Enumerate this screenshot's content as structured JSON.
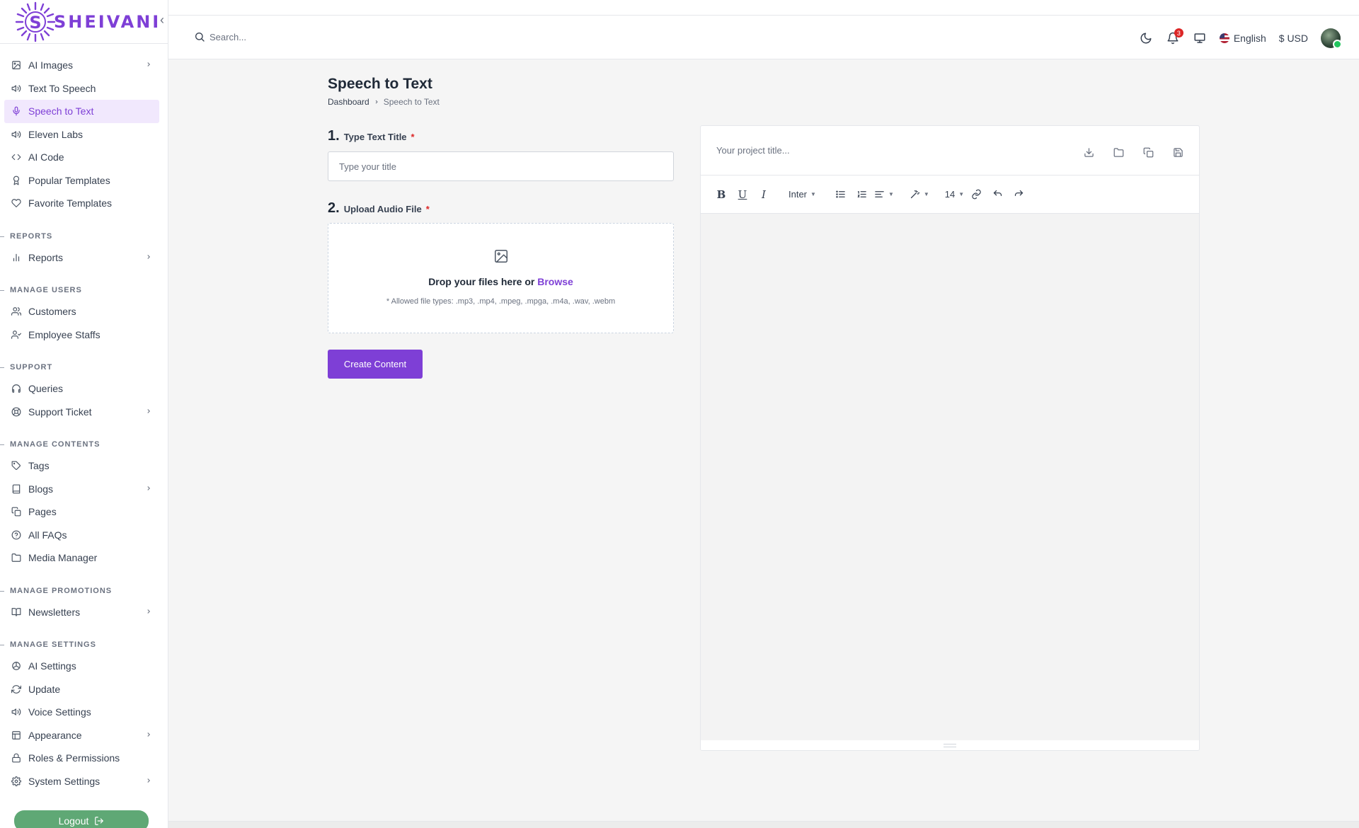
{
  "brand": {
    "name": "SHEIVANI"
  },
  "sidebar": {
    "items_main": [
      {
        "label": "AI Images",
        "icon": "image-icon",
        "chevron": true
      },
      {
        "label": "Text To Speech",
        "icon": "speaker-icon",
        "chevron": false
      },
      {
        "label": "Speech to Text",
        "icon": "microphone-icon",
        "chevron": false,
        "active": true
      },
      {
        "label": "Eleven Labs",
        "icon": "speaker-icon",
        "chevron": false
      },
      {
        "label": "AI Code",
        "icon": "code-icon",
        "chevron": false
      },
      {
        "label": "Popular Templates",
        "icon": "award-icon",
        "chevron": false
      },
      {
        "label": "Favorite Templates",
        "icon": "heart-icon",
        "chevron": false
      }
    ],
    "sections": [
      {
        "title": "REPORTS",
        "items": [
          {
            "label": "Reports",
            "icon": "bar-chart-icon",
            "chevron": true
          }
        ]
      },
      {
        "title": "MANAGE USERS",
        "items": [
          {
            "label": "Customers",
            "icon": "users-icon"
          },
          {
            "label": "Employee Staffs",
            "icon": "user-check-icon"
          }
        ]
      },
      {
        "title": "SUPPORT",
        "items": [
          {
            "label": "Queries",
            "icon": "headphones-icon"
          },
          {
            "label": "Support Ticket",
            "icon": "lifebuoy-icon",
            "chevron": true
          }
        ]
      },
      {
        "title": "MANAGE CONTENTS",
        "items": [
          {
            "label": "Tags",
            "icon": "tag-icon"
          },
          {
            "label": "Blogs",
            "icon": "book-icon",
            "chevron": true
          },
          {
            "label": "Pages",
            "icon": "copy-icon"
          },
          {
            "label": "All FAQs",
            "icon": "help-circle-icon"
          },
          {
            "label": "Media Manager",
            "icon": "folder-icon"
          }
        ]
      },
      {
        "title": "MANAGE PROMOTIONS",
        "items": [
          {
            "label": "Newsletters",
            "icon": "book-open-icon",
            "chevron": true
          }
        ]
      },
      {
        "title": "MANAGE SETTINGS",
        "items": [
          {
            "label": "AI Settings",
            "icon": "openai-icon"
          },
          {
            "label": "Update",
            "icon": "refresh-icon"
          },
          {
            "label": "Voice Settings",
            "icon": "speaker-icon"
          },
          {
            "label": "Appearance",
            "icon": "layout-icon",
            "chevron": true
          },
          {
            "label": "Roles & Permissions",
            "icon": "lock-icon"
          },
          {
            "label": "System Settings",
            "icon": "gear-icon",
            "chevron": true
          }
        ]
      }
    ],
    "logout_label": "Logout"
  },
  "header": {
    "search_placeholder": "Search...",
    "notification_count": "3",
    "language": "English",
    "currency": "$ USD"
  },
  "page": {
    "title": "Speech to Text",
    "breadcrumb": {
      "home": "Dashboard",
      "current": "Speech to Text"
    }
  },
  "form": {
    "step1": {
      "number": "1.",
      "label": "Type Text Title",
      "required_mark": "*",
      "placeholder": "Type your title"
    },
    "step2": {
      "number": "2.",
      "label": "Upload Audio File",
      "required_mark": "*"
    },
    "dropzone": {
      "text": "Drop your files here or",
      "browse": "Browse",
      "allowed": "* Allowed file types: .mp3, .mp4, .mpeg, .mpga, .m4a, .wav, .webm"
    },
    "submit_label": "Create Content"
  },
  "editor": {
    "title_placeholder": "Your project title...",
    "toolbar": {
      "bold": "B",
      "underline": "U",
      "italic": "I",
      "font": "Inter",
      "font_size": "14"
    }
  },
  "colors": {
    "accent": "#7e3fd6",
    "logout": "#5fa875",
    "badge": "#dc2626"
  }
}
